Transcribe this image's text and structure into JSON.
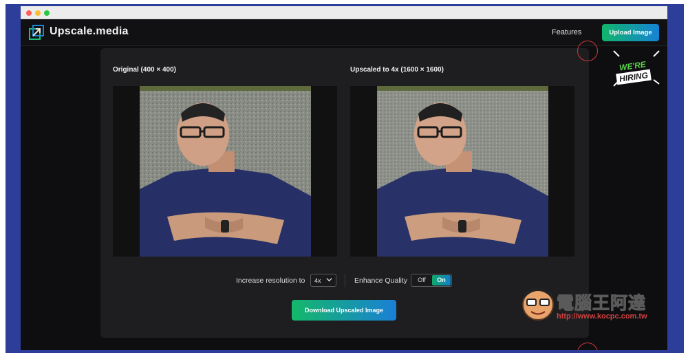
{
  "window": {
    "controls": [
      "close",
      "minimize",
      "zoom"
    ]
  },
  "appbar": {
    "logo_text": "Upscale.media",
    "logo_icon": "upscale-arrow-icon",
    "nav_features": "Features",
    "upload_button": "Upload Image"
  },
  "modal": {
    "original_title": "Original (400 × 400)",
    "upscaled_title": "Upscaled to 4x (1600 × 1600)",
    "resolution_label": "Increase resolution to",
    "resolution_value": "4x",
    "enhance_label": "Enhance Quality",
    "toggle_off": "Off",
    "toggle_on": "On",
    "enhance_state": "On",
    "download_button": "Download Upscaled Image"
  },
  "badge": {
    "line1": "WE'RE",
    "line2": "HIRING"
  },
  "watermark": {
    "title": "電腦王阿達",
    "url": "http://www.kocpc.com.tw"
  },
  "colors": {
    "accent_green": "#11b56b",
    "accent_blue": "#1583d6",
    "close_red": "#d03a3a",
    "frame_blue": "#2c3e9a"
  }
}
